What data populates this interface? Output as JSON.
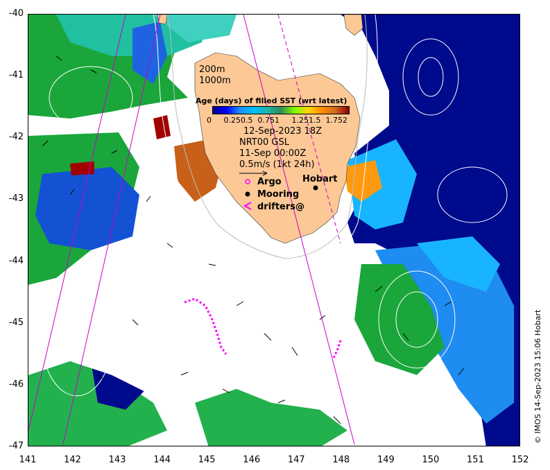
{
  "axes": {
    "x_ticks": [
      "141",
      "142",
      "143",
      "144",
      "145",
      "146",
      "147",
      "148",
      "149",
      "150",
      "151",
      "152"
    ],
    "y_ticks": [
      "-40",
      "-41",
      "-42",
      "-43",
      "-44",
      "-45",
      "-46",
      "-47"
    ],
    "xlim": [
      141,
      152
    ],
    "ylim": [
      -47,
      -40
    ]
  },
  "colorbar": {
    "title": "Age (days) of filled SST (wrt latest)",
    "ticks": [
      "0",
      "0.25",
      "0.5",
      "0.75",
      "1",
      "1.25",
      "1.5",
      "1.75",
      "2"
    ],
    "colors": [
      "#00008b",
      "#0000ff",
      "#1e90ff",
      "#00bfff",
      "#20b2aa",
      "#2e8b57",
      "#7cfc00",
      "#ffd700",
      "#ff8c00",
      "#d2691e",
      "#8b0000"
    ]
  },
  "contours": {
    "label_200": "200m",
    "label_1000": "1000m"
  },
  "sst_date": "12-Sep-2023 18Z",
  "currents": {
    "model": "NRT00 GSL",
    "time": "11-Sep 00:00Z",
    "scale": "0.5m/s (1kt 24h)"
  },
  "legend": {
    "argo": "Argo",
    "mooring": "Mooring",
    "drifters": "drifters@"
  },
  "place": "Hobart",
  "credit": "© IMOS 14-Sep-2023 15:06 Hobart",
  "colors": {
    "land": "#fcc896",
    "ocean_deep": "#000a8c",
    "argo": "#ff00ff",
    "drifter": "#ff00ff"
  }
}
